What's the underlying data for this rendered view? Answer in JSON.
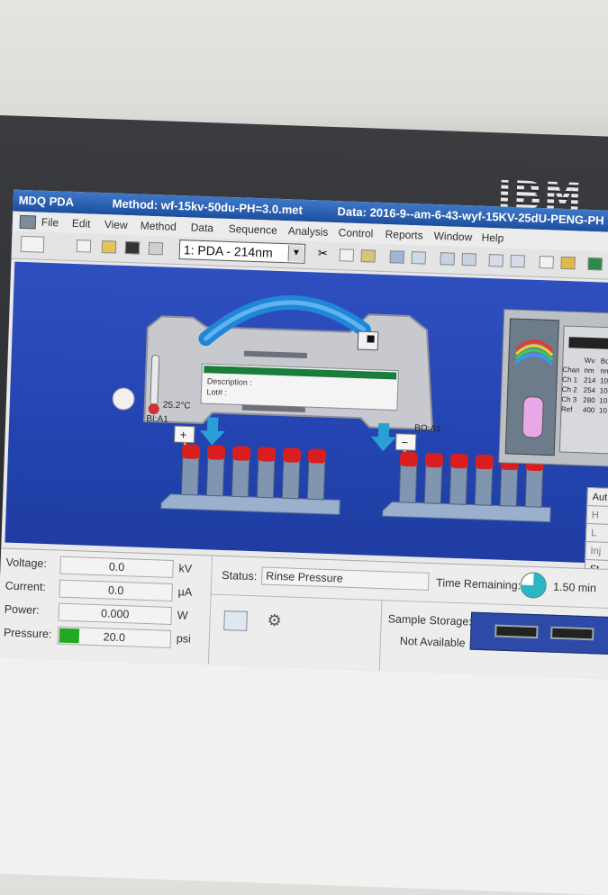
{
  "brand": "IBM",
  "titlebar": {
    "app": "MDQ PDA",
    "method": "Method: wf-15kv-50du-PH=3.0.met",
    "data": "Data: 2016-9--am-6-43-wyf-15KV-25dU-PENG-PH"
  },
  "menu": [
    "File",
    "Edit",
    "View",
    "Method",
    "Data",
    "Sequence",
    "Analysis",
    "Control",
    "Reports",
    "Window",
    "Help"
  ],
  "toolbar": {
    "method_select": "1: PDA - 214nm"
  },
  "instrument": {
    "description_label": "Description :",
    "lot_label": "Lot# :",
    "temperature": "25.2°C",
    "inlet_label": "BI:A1",
    "outlet_label": "BO:A1",
    "plus": "+",
    "minus": "−"
  },
  "detector": {
    "headers": [
      [
        "",
        "Wv",
        "Bd"
      ],
      [
        "Chan",
        "nm",
        "nm"
      ]
    ],
    "rows": [
      [
        "Ch 1",
        "214",
        "10"
      ],
      [
        "Ch 2",
        "254",
        "10"
      ],
      [
        "Ch 3",
        "280",
        "10"
      ],
      [
        "Ref",
        "400",
        "10"
      ]
    ]
  },
  "right_buttons": [
    "Aut",
    "H",
    "L",
    "Inj",
    "St"
  ],
  "readouts": [
    {
      "label": "Voltage:",
      "value": "0.0",
      "unit": "kV"
    },
    {
      "label": "Current:",
      "value": "0.0",
      "unit": "µA"
    },
    {
      "label": "Power:",
      "value": "0.000",
      "unit": "W"
    },
    {
      "label": "Pressure:",
      "value": "20.0",
      "unit": "psi"
    }
  ],
  "status": {
    "label": "Status:",
    "value": "Rinse Pressure",
    "time_label": "Time Remaining:",
    "time_value": "1.50 min",
    "time_fraction": 0.75
  },
  "storage": {
    "label": "Sample Storage:",
    "value": "Not Available"
  },
  "colors": {
    "title": "#1c4e9e",
    "panel": "#2344b0",
    "vial_cap": "#d81e1e",
    "pressure_bar": "#22a822"
  }
}
